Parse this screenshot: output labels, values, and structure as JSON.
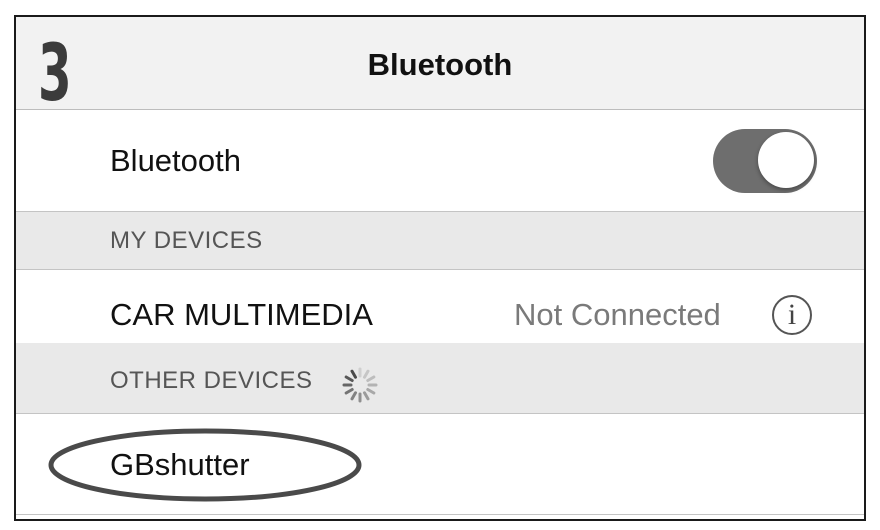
{
  "step_number": "3",
  "navbar": {
    "title": "Bluetooth"
  },
  "bluetooth_row": {
    "label": "Bluetooth",
    "toggle_on": true
  },
  "sections": {
    "my_devices": {
      "header": "MY DEVICES"
    },
    "other_devices": {
      "header": "OTHER DEVICES",
      "searching": true
    }
  },
  "devices": {
    "my": [
      {
        "name": "CAR MULTIMEDIA",
        "status": "Not Connected",
        "info_icon": "info-circle-icon"
      }
    ],
    "other": [
      {
        "name": "GBshutter",
        "highlighted": true
      }
    ]
  },
  "colors": {
    "toggle_track": "#6e6e6e",
    "section_bg": "#e9e9e9",
    "navbar_bg": "#f2f2f2",
    "highlight_ring": "#4a4a4a"
  }
}
